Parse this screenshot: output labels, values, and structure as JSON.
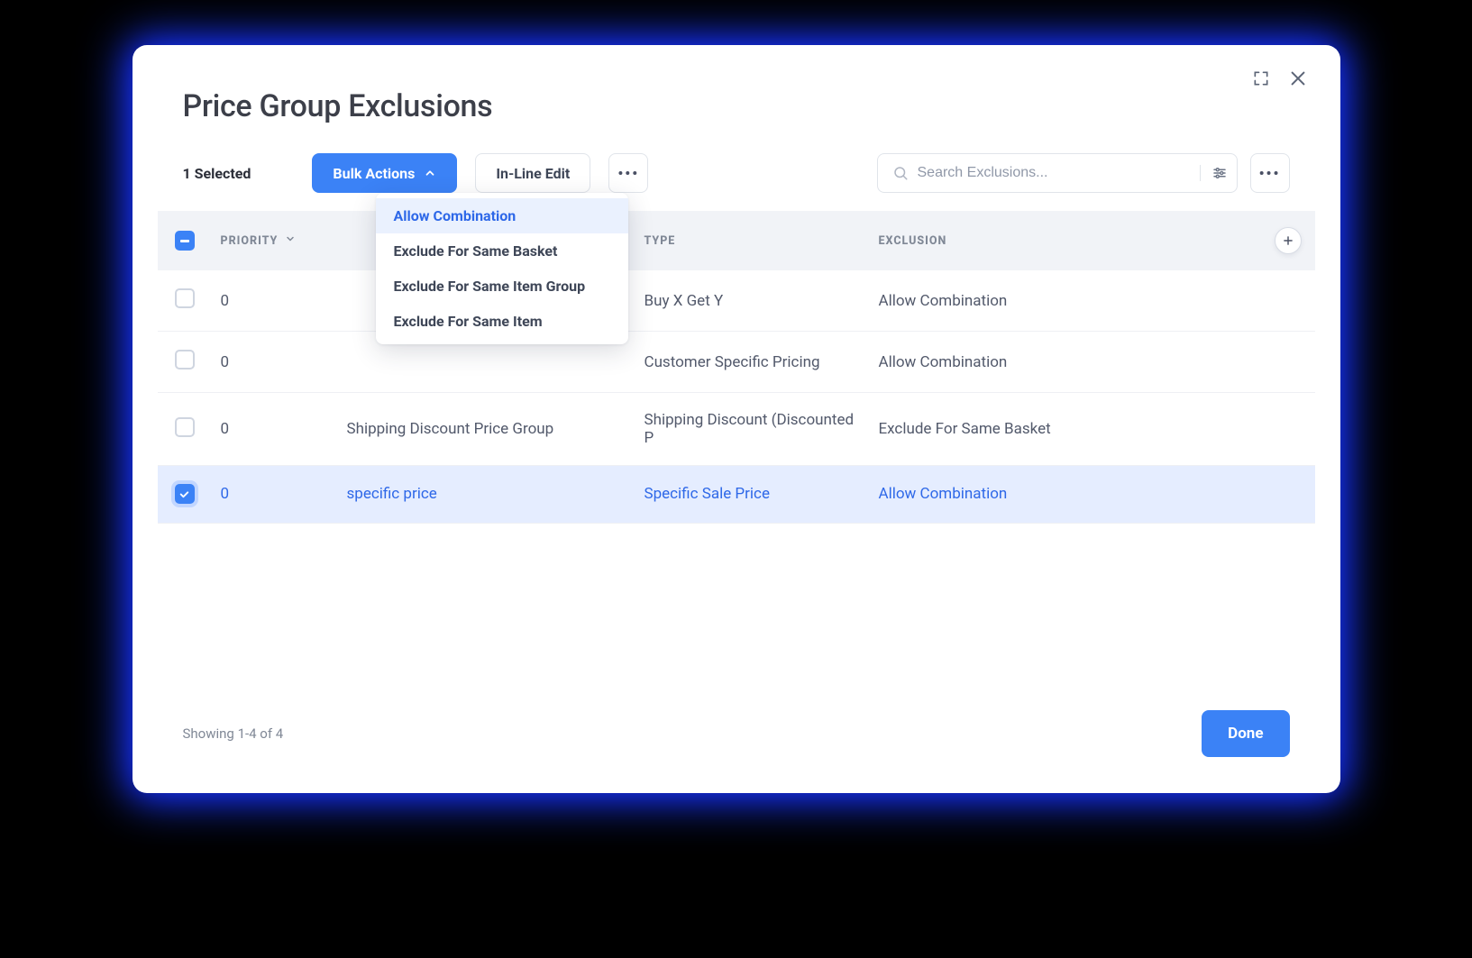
{
  "modal": {
    "title": "Price Group Exclusions",
    "selected_text": "1 Selected",
    "bulk_actions_label": "Bulk Actions",
    "inline_edit_label": "In-Line Edit",
    "search_placeholder": "Search Exclusions...",
    "done_label": "Done",
    "footer_text": "Showing 1-4 of 4"
  },
  "dropdown": {
    "items": [
      "Allow Combination",
      "Exclude For Same Basket",
      "Exclude For Same Item Group",
      "Exclude For Same Item"
    ]
  },
  "table": {
    "headers": {
      "priority": "Priority",
      "type": "Type",
      "exclusion": "Exclusion"
    },
    "rows": [
      {
        "priority": "0",
        "group": "",
        "type": "Buy X Get Y",
        "exclusion": "Allow Combination",
        "selected": false
      },
      {
        "priority": "0",
        "group": "",
        "type": "Customer Specific Pricing",
        "exclusion": "Allow Combination",
        "selected": false
      },
      {
        "priority": "0",
        "group": "Shipping Discount Price Group",
        "type": "Shipping Discount (Discounted P",
        "exclusion": "Exclude For Same Basket",
        "selected": false
      },
      {
        "priority": "0",
        "group": "specific price",
        "type": "Specific Sale Price",
        "exclusion": "Allow Combination",
        "selected": true
      }
    ]
  }
}
